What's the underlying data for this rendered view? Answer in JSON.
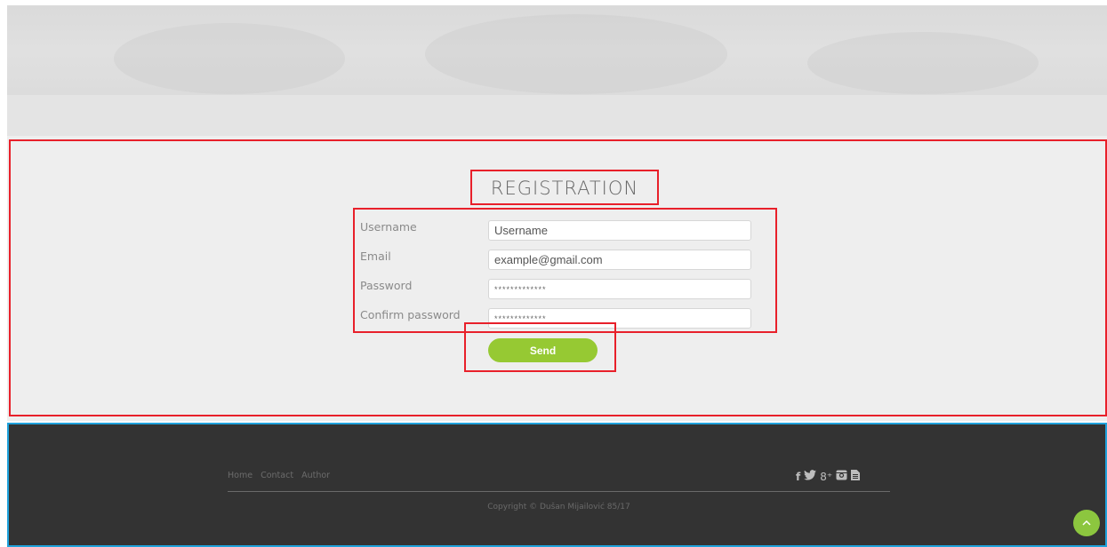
{
  "registration": {
    "title": "REGISTRATION",
    "fields": [
      {
        "label": "Username",
        "value": "Username",
        "type": "text"
      },
      {
        "label": "Email",
        "value": "example@gmail.com",
        "type": "text"
      },
      {
        "label": "Password",
        "value": "*************",
        "type": "password"
      },
      {
        "label": "Confirm password",
        "value": "*************",
        "type": "password"
      }
    ],
    "send_label": "Send"
  },
  "footer": {
    "nav": [
      "Home",
      "Contact",
      "Author"
    ],
    "social_icons": [
      "facebook-icon",
      "twitter-icon",
      "google-plus-icon",
      "instagram-icon",
      "document-icon"
    ],
    "social_glyphs": [
      "f",
      "🐦",
      "8⁺",
      "▣",
      "▤"
    ],
    "copyright": "Copyright © Dušan Mijailović 85/17",
    "to_top_glyph": "^"
  },
  "colors": {
    "accent": "#96c933",
    "footer_bg": "#333333",
    "annotation_red": "#e8202a",
    "annotation_blue": "#1fa2dc"
  }
}
